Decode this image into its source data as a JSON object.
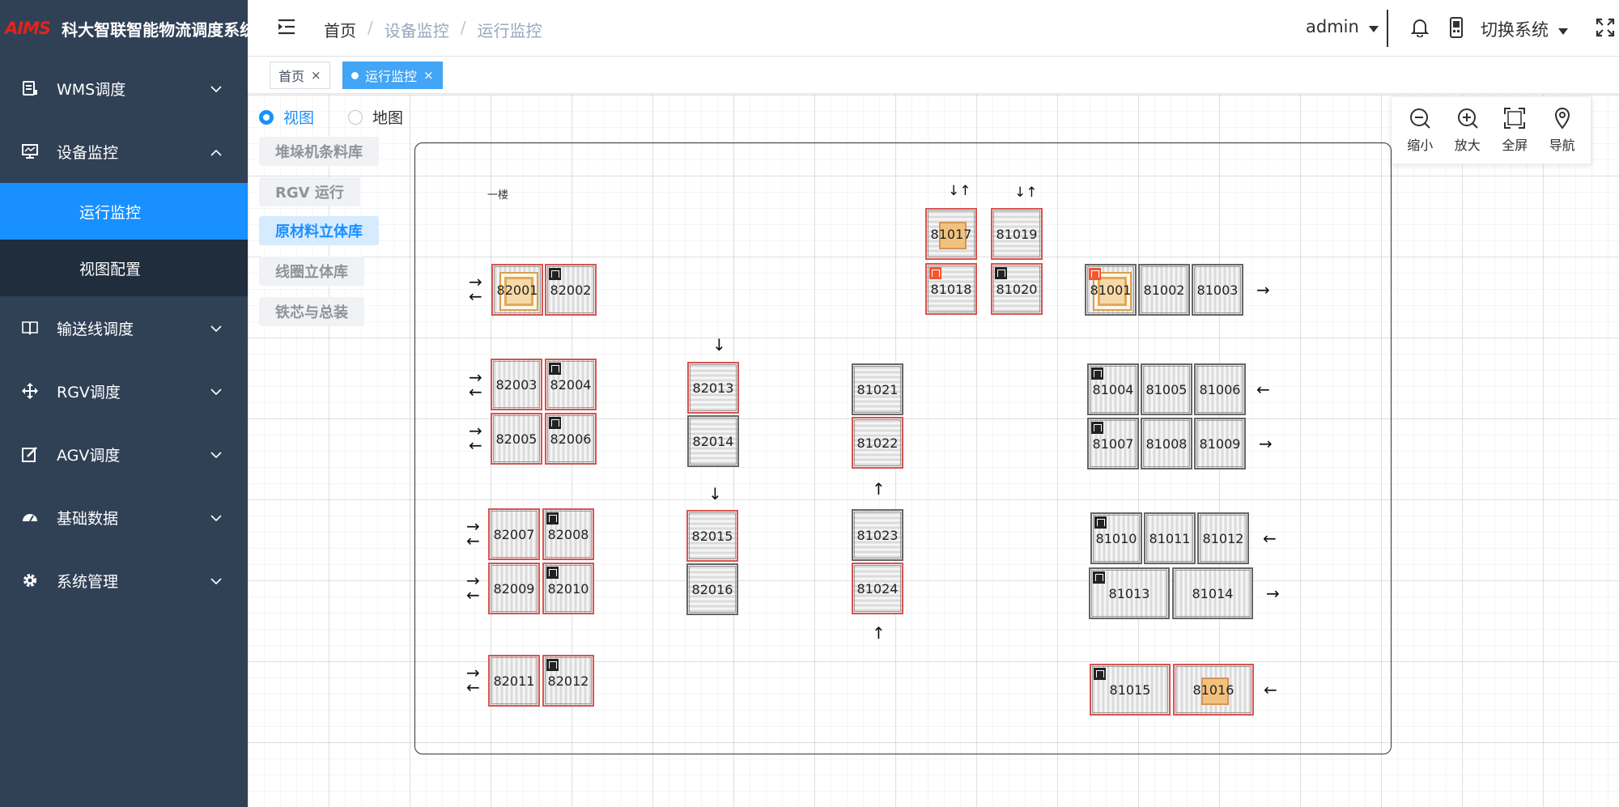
{
  "app": {
    "logo": "AIMS",
    "title": "科大智联智能物流调度系统"
  },
  "sidebar": {
    "items": [
      {
        "label": "WMS调度",
        "icon": "server-icon"
      },
      {
        "label": "设备监控",
        "icon": "monitor-icon",
        "expanded": true,
        "children": [
          {
            "label": "运行监控",
            "active": true
          },
          {
            "label": "视图配置"
          }
        ]
      },
      {
        "label": "输送线调度",
        "icon": "book-icon"
      },
      {
        "label": "RGV调度",
        "icon": "move-icon"
      },
      {
        "label": "AGV调度",
        "icon": "edit-icon"
      },
      {
        "label": "基础数据",
        "icon": "dashboard-icon"
      },
      {
        "label": "系统管理",
        "icon": "gear-icon"
      }
    ]
  },
  "header": {
    "breadcrumb": [
      "首页",
      "设备监控",
      "运行监控"
    ],
    "user": "admin",
    "switch_label": "切换系统"
  },
  "tags": [
    {
      "label": "首页"
    },
    {
      "label": "运行监控",
      "active": true
    }
  ],
  "view_mode": {
    "options": [
      "视图",
      "地图"
    ],
    "selected": "视图"
  },
  "areas": [
    "堆垛机条料库",
    "RGV 运行",
    "原材料立体库",
    "线圈立体库",
    "铁芯与总装"
  ],
  "active_area": "原材料立体库",
  "toolbar": {
    "zoom_out": "缩小",
    "zoom_in": "放大",
    "fullscreen": "全屏",
    "navigate": "导航"
  },
  "map": {
    "floor_label": "一楼",
    "cells": {
      "c82001": "82001",
      "c82002": "82002",
      "c82003": "82003",
      "c82004": "82004",
      "c82005": "82005",
      "c82006": "82006",
      "c82007": "82007",
      "c82008": "82008",
      "c82009": "82009",
      "c82010": "82010",
      "c82011": "82011",
      "c82012": "82012",
      "c82013": "82013",
      "c82014": "82014",
      "c82015": "82015",
      "c82016": "82016",
      "c81021": "81021",
      "c81022": "81022",
      "c81023": "81023",
      "c81024": "81024",
      "c81017": "81017",
      "c81018": "81018",
      "c81019": "81019",
      "c81020": "81020",
      "c81001": "81001",
      "c81002": "81002",
      "c81003": "81003",
      "c81004": "81004",
      "c81005": "81005",
      "c81006": "81006",
      "c81007": "81007",
      "c81008": "81008",
      "c81009": "81009",
      "c81010": "81010",
      "c81011": "81011",
      "c81012": "81012",
      "c81013": "81013",
      "c81014": "81014",
      "c81015": "81015",
      "c81016": "81016"
    },
    "arrows": {
      "right": "→",
      "left": "←",
      "down": "↓",
      "up": "↑",
      "updown": "↓↑",
      "rightleft": "→\n←"
    }
  }
}
